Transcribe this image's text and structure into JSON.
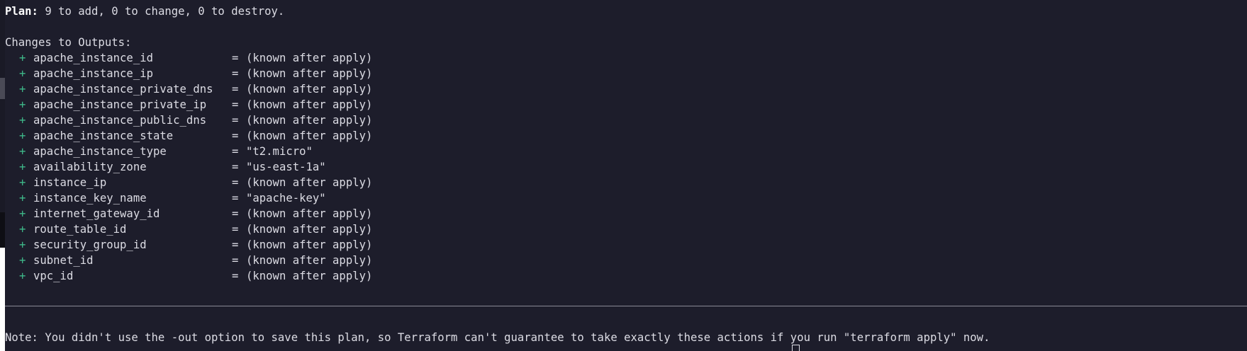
{
  "plan": {
    "label": "Plan:",
    "summary": " 9 to add, 0 to change, 0 to destroy."
  },
  "changes_heading": "Changes to Outputs:",
  "outputs": [
    {
      "sign": "+",
      "name": "apache_instance_id",
      "value": "(known after apply)"
    },
    {
      "sign": "+",
      "name": "apache_instance_ip",
      "value": "(known after apply)"
    },
    {
      "sign": "+",
      "name": "apache_instance_private_dns",
      "value": "(known after apply)"
    },
    {
      "sign": "+",
      "name": "apache_instance_private_ip",
      "value": "(known after apply)"
    },
    {
      "sign": "+",
      "name": "apache_instance_public_dns",
      "value": "(known after apply)"
    },
    {
      "sign": "+",
      "name": "apache_instance_state",
      "value": "(known after apply)"
    },
    {
      "sign": "+",
      "name": "apache_instance_type",
      "value": "\"t2.micro\""
    },
    {
      "sign": "+",
      "name": "availability_zone",
      "value": "\"us-east-1a\""
    },
    {
      "sign": "+",
      "name": "instance_ip",
      "value": "(known after apply)"
    },
    {
      "sign": "+",
      "name": "instance_key_name",
      "value": "\"apache-key\""
    },
    {
      "sign": "+",
      "name": "internet_gateway_id",
      "value": "(known after apply)"
    },
    {
      "sign": "+",
      "name": "route_table_id",
      "value": "(known after apply)"
    },
    {
      "sign": "+",
      "name": "security_group_id",
      "value": "(known after apply)"
    },
    {
      "sign": "+",
      "name": "subnet_id",
      "value": "(known after apply)"
    },
    {
      "sign": "+",
      "name": "vpc_id",
      "value": "(known after apply)"
    }
  ],
  "equals": "=",
  "note": "Note: You didn't use the -out option to save this plan, so Terraform can't guarantee to take exactly these actions if you run \"terraform apply\" now.",
  "colors": {
    "background": "#1d1d2b",
    "text": "#dcdce4",
    "plus_sign": "#3fb98a",
    "separator": "#8a8a96"
  }
}
